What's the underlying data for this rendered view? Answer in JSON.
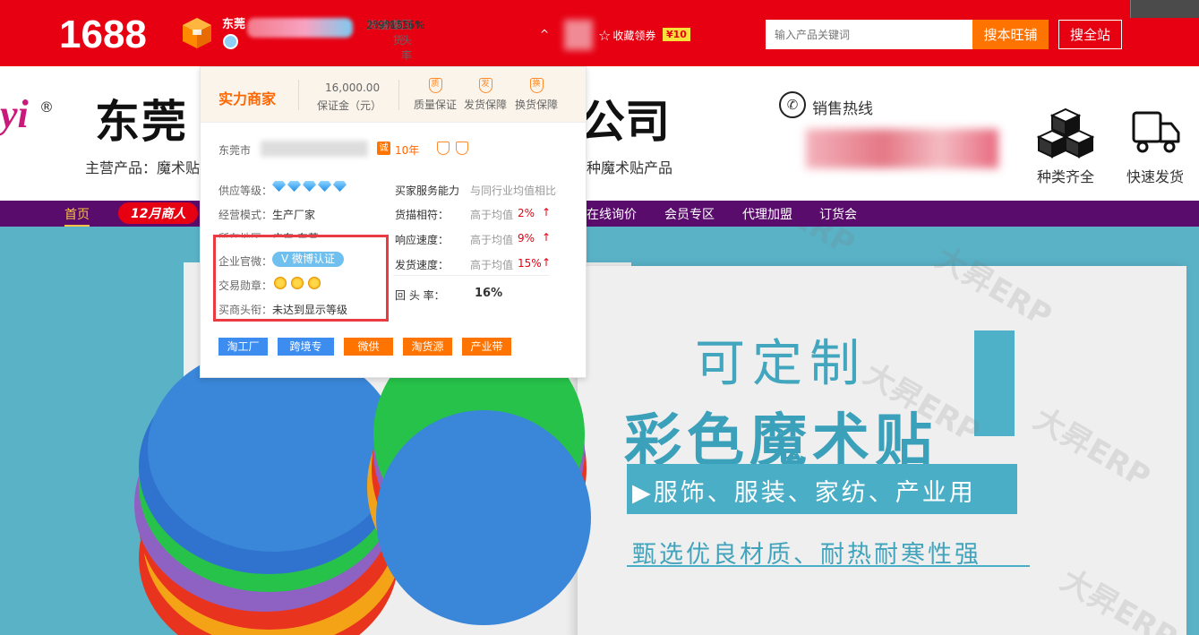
{
  "topbar": {
    "logo": "1688",
    "shop_name": "东莞",
    "stats": [
      {
        "label": "货描",
        "value": "2%↑"
      },
      {
        "label": "响应",
        "value": "9%↑"
      },
      {
        "label": "发货",
        "value": "15%↑"
      },
      {
        "label": "回头率",
        "value": "16%"
      }
    ],
    "collapse": "^",
    "favorite_label": "收藏领券",
    "coupon_label": "¥10",
    "search_placeholder": "输入产品关键词",
    "search_shop_btn": "搜本旺铺",
    "search_all_btn": "搜全站"
  },
  "header": {
    "brand_mark": "yi",
    "registered": "®",
    "company_name_left": "东莞",
    "company_name_right": "公司",
    "main_products_label": "主营产品：魔术贴",
    "main_products_tail": "种魔术贴产品",
    "hotline_label": "销售热线",
    "features": [
      {
        "label": "种类齐全",
        "icon": "cubes-icon"
      },
      {
        "label": "快速发货",
        "icon": "truck-icon"
      }
    ]
  },
  "nav": {
    "items": [
      {
        "label": "首页",
        "active": true
      },
      {
        "label": "在线询价"
      },
      {
        "label": "会员专区"
      },
      {
        "label": "代理加盟"
      },
      {
        "label": "订货会"
      }
    ],
    "promo": "12月商人"
  },
  "banner": {
    "title1": "可定制",
    "title2": "彩色魔术贴",
    "subtitle": "▶服饰、服装、家纺、产业用",
    "tagline": "甄选优良材质、耐热耐寒性强",
    "watermark": "大昇ERP"
  },
  "popup": {
    "title": "实力商家",
    "deposit_value": "16,000.00",
    "deposit_label": "保证金（元）",
    "guarantees": [
      {
        "label": "质量保证",
        "glyph": "质"
      },
      {
        "label": "发货保障",
        "glyph": "发"
      },
      {
        "label": "换货保障",
        "glyph": "换"
      }
    ],
    "location_prefix": "东莞市",
    "cheng_badge": "诚",
    "years": "10年",
    "left_rows": [
      {
        "label": "供应等级：",
        "value": ""
      },
      {
        "label": "经营模式：",
        "value": "生产厂家"
      },
      {
        "label": "所在地区：",
        "value": "广东 东莞"
      },
      {
        "label": "企业官微：",
        "value": "微博认证"
      },
      {
        "label": "交易勋章：",
        "value": ""
      },
      {
        "label": "买商头衔：",
        "value": "未达到显示等级"
      }
    ],
    "service_title": "买家服务能力",
    "service_compare": "与同行业均值相比",
    "service_rows": [
      {
        "label": "货描相符：",
        "value": "高于均值",
        "pct": "2%",
        "arrow": "↑"
      },
      {
        "label": "响应速度：",
        "value": "高于均值",
        "pct": "9%",
        "arrow": "↑"
      },
      {
        "label": "发货速度：",
        "value": "高于均值",
        "pct": "15%",
        "arrow": "↑"
      }
    ],
    "return_label": "回 头 率：",
    "return_value": "16%",
    "tags": [
      {
        "label": "淘工厂",
        "color": "#3d8df0"
      },
      {
        "label": "跨境专供",
        "color": "#3d8df0"
      },
      {
        "label": "微供",
        "color": "#ff7300"
      },
      {
        "label": "淘货源",
        "color": "#ff7300"
      },
      {
        "label": "产业带",
        "color": "#ff7300"
      }
    ]
  }
}
